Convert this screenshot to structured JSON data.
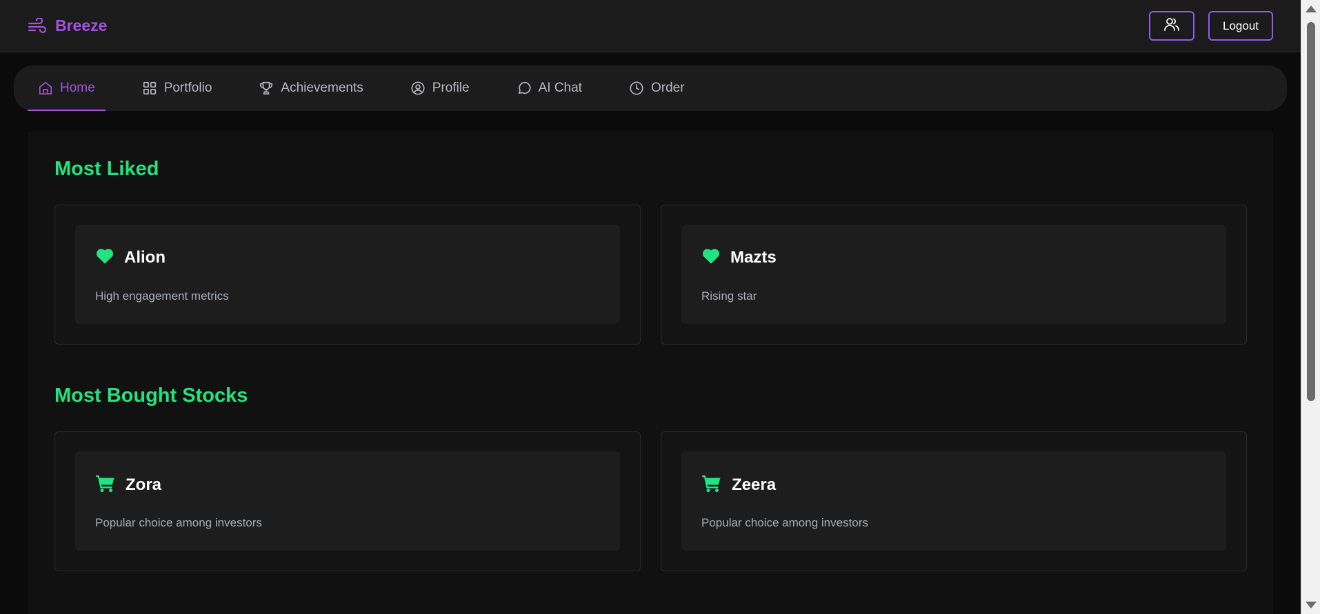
{
  "brand": {
    "name": "Breeze",
    "icon": "wind-icon"
  },
  "header": {
    "users_icon": "users-icon",
    "logout_label": "Logout"
  },
  "nav": {
    "items": [
      {
        "label": "Home",
        "icon": "home-icon",
        "active": true
      },
      {
        "label": "Portfolio",
        "icon": "grid-icon",
        "active": false
      },
      {
        "label": "Achievements",
        "icon": "trophy-icon",
        "active": false
      },
      {
        "label": "Profile",
        "icon": "user-circle-icon",
        "active": false
      },
      {
        "label": "AI Chat",
        "icon": "chat-bubble-icon",
        "active": false
      },
      {
        "label": "Order",
        "icon": "clock-icon",
        "active": false
      }
    ]
  },
  "sections": {
    "most_liked": {
      "title": "Most Liked",
      "cards": [
        {
          "name": "Alion",
          "description": "High engagement metrics",
          "icon": "heart-icon"
        },
        {
          "name": "Mazts",
          "description": "Rising star",
          "icon": "heart-icon"
        }
      ]
    },
    "most_bought": {
      "title": "Most Bought Stocks",
      "cards": [
        {
          "name": "Zora",
          "description": "Popular choice among investors",
          "icon": "cart-icon"
        },
        {
          "name": "Zeera",
          "description": "Popular choice among investors",
          "icon": "cart-icon"
        }
      ]
    }
  },
  "colors": {
    "accent_purple": "#a74fe3",
    "accent_green": "#22e37f",
    "background": "#0b0b0b",
    "header_bg": "#1b1b1b"
  }
}
